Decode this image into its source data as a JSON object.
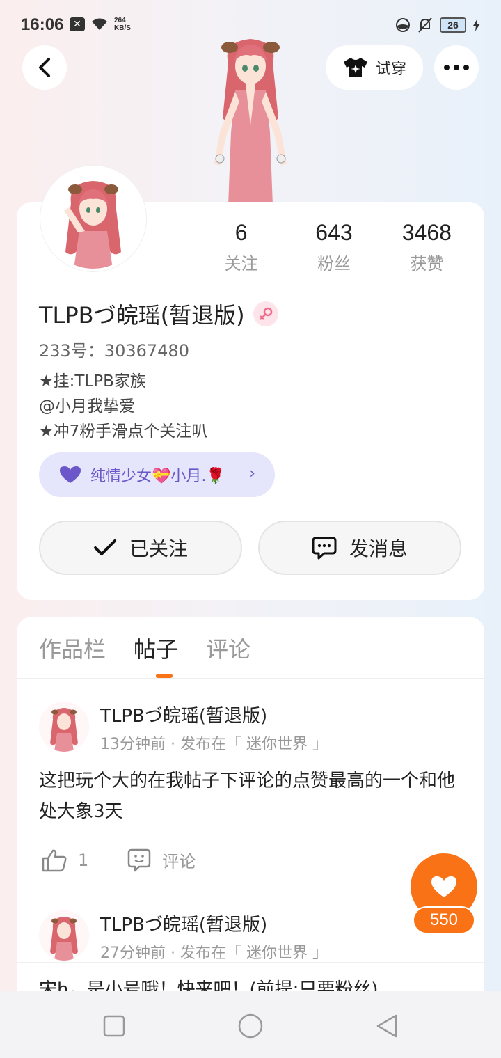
{
  "status_bar": {
    "time": "16:06",
    "net_speed_value": "264",
    "net_speed_unit": "KB/S",
    "battery": "26"
  },
  "header": {
    "tryon_label": "试穿"
  },
  "profile": {
    "stats": [
      {
        "value": "6",
        "label": "关注"
      },
      {
        "value": "643",
        "label": "粉丝"
      },
      {
        "value": "3468",
        "label": "获赞"
      }
    ],
    "username": "TLPBづ皖瑶(暂退版)",
    "uid": "233号：30367480",
    "bio": [
      "★挂:TLPB家族",
      "@小月我挚爱",
      "★冲7粉手滑点个关注叭"
    ],
    "cp_tag": "纯情少女💝小月.🌹",
    "follow_label": "已关注",
    "message_label": "发消息"
  },
  "tabs": [
    "作品栏",
    "帖子",
    "评论"
  ],
  "active_tab": "帖子",
  "posts": [
    {
      "author": "TLPBづ皖瑶(暂退版)",
      "meta": "13分钟前 · 发布在「 迷你世界 」",
      "text": "这把玩个大的在我帖子下评论的点赞最高的一个和他处大象3天",
      "likes": "1",
      "comment_label": "评论"
    },
    {
      "author": "TLPBづ皖瑶(暂退版)",
      "meta": "27分钟前 · 发布在「 迷你世界 」",
      "text": "宋h，是小号哦！快来吧！(前提:只要粉丝)"
    }
  ],
  "floating_like": {
    "count": "550"
  },
  "colors": {
    "accent": "#f97316",
    "cp_tag_bg": "#e5e5fb",
    "cp_tag_text": "#6b57c9"
  }
}
